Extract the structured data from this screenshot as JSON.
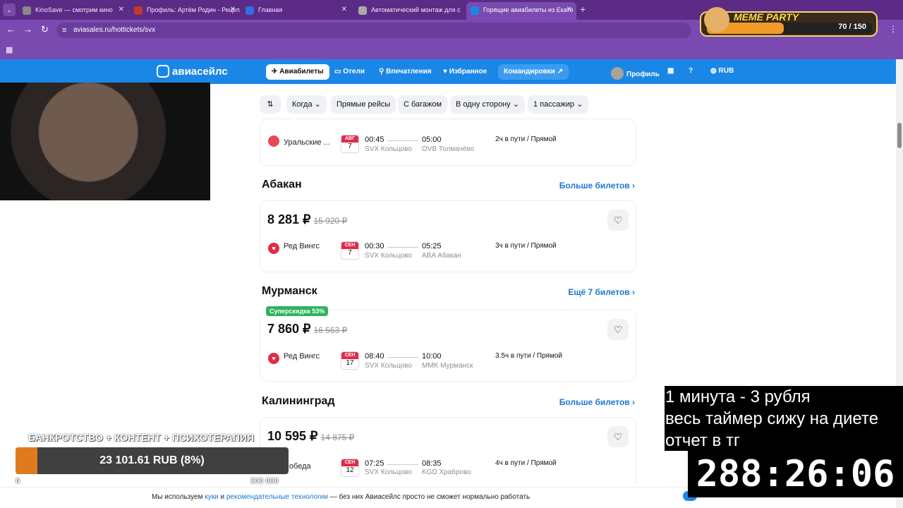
{
  "browser": {
    "tabs": [
      {
        "title": "KinoSave — смотрим кино",
        "favicon_color": "#888888"
      },
      {
        "title": "Профиль: Артём Родин - Рецеп",
        "favicon_color": "#c0392b"
      },
      {
        "title": "Главная",
        "favicon_color": "#2f6fe0"
      },
      {
        "title": "Автоматический монтаж для с",
        "favicon_color": "#aaaaaa"
      },
      {
        "title": "Горящие авиабилеты из Екате",
        "favicon_color": "#1a87e6",
        "active": true
      }
    ],
    "url": "aviasales.ru/hottickets/svx"
  },
  "site": {
    "logo": "авиасейлс",
    "nav": [
      "Авиабилеты",
      "Отели",
      "Впечатления",
      "Избранное",
      "Командировки ↗"
    ],
    "profile": "Профиль",
    "currency": "RUB"
  },
  "filters": [
    "Когда",
    "Прямые рейсы",
    "С багажом",
    "В одну сторону",
    "1 пассажир"
  ],
  "top_card": {
    "airline": "Уральские ...",
    "date_month": "АВГ",
    "date_day": "7",
    "dep_time": "00:45",
    "dep_airport": "SVX Кольцово",
    "arr_time": "05:00",
    "arr_airport": "OVB Толмачёво",
    "duration": "2ч в пути / Прямой"
  },
  "sections": [
    {
      "city": "Абакан",
      "more": "Больше билетов ›",
      "price": "8 281 ₽",
      "old_price": "15 920 ₽",
      "badge": "",
      "airline": "Ред Вингс",
      "date_month": "СЕН",
      "date_day": "7",
      "dep_time": "00:30",
      "dep_airport": "SVX Кольцово",
      "arr_time": "05:25",
      "arr_airport": "ABA Абакан",
      "duration": "3ч в пути / Прямой"
    },
    {
      "city": "Мурманск",
      "more": "Ещё 7 билетов ›",
      "price": "7 860 ₽",
      "old_price": "16 563 ₽",
      "badge": "Суперскидка 53%",
      "airline": "Ред Вингс",
      "date_month": "СЕН",
      "date_day": "17",
      "dep_time": "08:40",
      "dep_airport": "SVX Кольцово",
      "arr_time": "10:00",
      "arr_airport": "MMK Мурманск",
      "duration": "3.5ч в пути / Прямой"
    },
    {
      "city": "Калининград",
      "more": "Больше билетов ›",
      "price": "10 595 ₽",
      "old_price": "14 875 ₽",
      "badge": "",
      "airline": "Победа",
      "date_month": "СЕН",
      "date_day": "12",
      "dep_time": "07:25",
      "dep_airport": "SVX Кольцово",
      "arr_time": "08:35",
      "arr_airport": "KGD Храброво",
      "duration": "4ч в пути / Прямой"
    }
  ],
  "cookie": {
    "prefix": "Мы используем ",
    "link1": "куки",
    "mid": " и ",
    "link2": "рекомендательные технологии",
    "suffix": " — без них Авиасейлс просто не сможет нормально работать"
  },
  "stream": {
    "goal_title": "БАНКРОТСТВО + КОНТЕНТ + ПСИХОТЕРАПИЯ",
    "goal_text": "23 101.61 RUB (8%)",
    "goal_fraction": 0.08,
    "goal_min": "0",
    "goal_max": "300 000",
    "overlay_lines": [
      "1 минута - 3 рубля",
      "весь таймер сижу на диете",
      "отчет в тг"
    ],
    "timer": "288:26:06",
    "meme_title": "MEME PARTY",
    "meme_progress": "70 / 150",
    "meme_fraction": 0.4667
  }
}
